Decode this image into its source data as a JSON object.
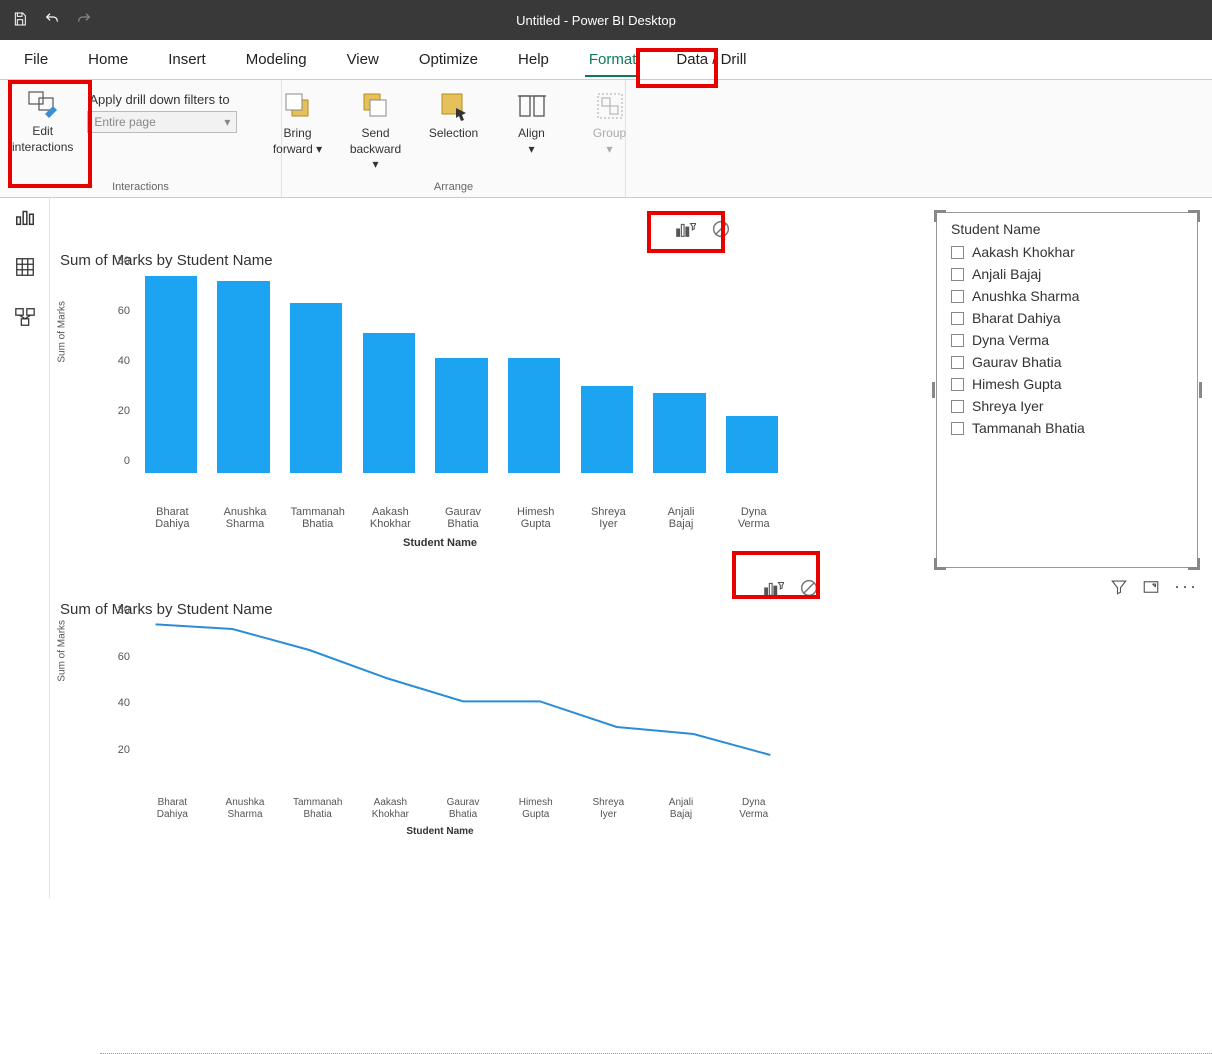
{
  "titlebar": {
    "title": "Untitled - Power BI Desktop"
  },
  "tabs": [
    "File",
    "Home",
    "Insert",
    "Modeling",
    "View",
    "Optimize",
    "Help",
    "Format",
    "Data / Drill"
  ],
  "active_tab": "Format",
  "ribbon": {
    "edit_interactions": {
      "line1": "Edit",
      "line2": "interactions"
    },
    "drill_label": "Apply drill down filters to",
    "drill_value": "Entire page",
    "interactions_group": "Interactions",
    "bring_forward": {
      "line1": "Bring",
      "line2": "forward"
    },
    "send_backward": {
      "line1": "Send",
      "line2": "backward"
    },
    "selection": "Selection",
    "align": "Align",
    "group": "Group",
    "arrange_group": "Arrange"
  },
  "slicer": {
    "header": "Student Name",
    "items": [
      "Aakash Khokhar",
      "Anjali Bajaj",
      "Anushka Sharma",
      "Bharat Dahiya",
      "Dyna Verma",
      "Gaurav Bhatia",
      "Himesh Gupta",
      "Shreya Iyer",
      "Tammanah Bhatia"
    ]
  },
  "chart_data": [
    {
      "type": "bar",
      "title": "Sum of Marks by Student Name",
      "xlabel": "Student Name",
      "ylabel": "Sum of Marks",
      "ylim": [
        0,
        80
      ],
      "yticks": [
        0,
        20,
        40,
        60,
        80
      ],
      "categories": [
        "Bharat Dahiya",
        "Anushka Sharma",
        "Tammanah Bhatia",
        "Aakash Khokhar",
        "Gaurav Bhatia",
        "Himesh Gupta",
        "Shreya Iyer",
        "Anjali Bajaj",
        "Dyna Verma"
      ],
      "values": [
        79,
        77,
        68,
        56,
        46,
        46,
        35,
        32,
        23
      ]
    },
    {
      "type": "line",
      "title": "Sum of Marks by Student Name",
      "xlabel": "Student Name",
      "ylabel": "Sum of Marks",
      "ylim": [
        20,
        80
      ],
      "yticks": [
        20,
        40,
        60,
        80
      ],
      "categories": [
        "Bharat Dahiya",
        "Anushka Sharma",
        "Tammanah Bhatia",
        "Aakash Khokhar",
        "Gaurav Bhatia",
        "Himesh Gupta",
        "Shreya Iyer",
        "Anjali Bajaj",
        "Dyna Verma"
      ],
      "values": [
        79,
        77,
        68,
        56,
        46,
        46,
        35,
        32,
        23
      ]
    }
  ]
}
